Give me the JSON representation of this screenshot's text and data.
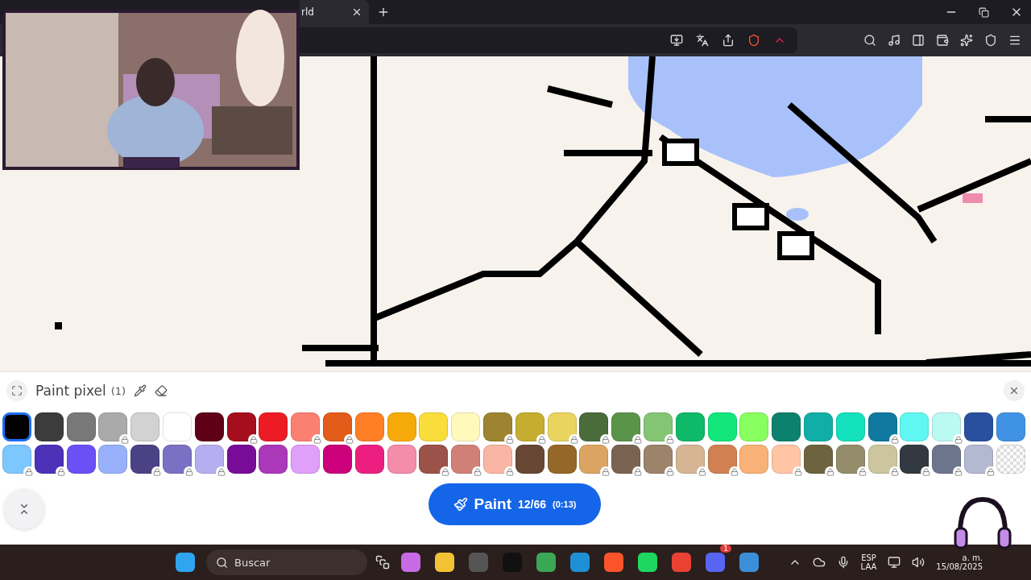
{
  "browser": {
    "tab": {
      "title": "rld"
    }
  },
  "panel": {
    "title": "Paint pixel",
    "count": "(1)",
    "palette": [
      {
        "kind": "color",
        "color": "#000000",
        "locked": false,
        "selected": true
      },
      {
        "kind": "color",
        "color": "#3c3c3c",
        "locked": false,
        "selected": false
      },
      {
        "kind": "color",
        "color": "#787878",
        "locked": false,
        "selected": false
      },
      {
        "kind": "color",
        "color": "#aaaaaa",
        "locked": true,
        "selected": false
      },
      {
        "kind": "color",
        "color": "#d2d2d2",
        "locked": false,
        "selected": false
      },
      {
        "kind": "color",
        "color": "#ffffff",
        "locked": false,
        "selected": false
      },
      {
        "kind": "color",
        "color": "#600018",
        "locked": false,
        "selected": false
      },
      {
        "kind": "color",
        "color": "#a50e1e",
        "locked": true,
        "selected": false
      },
      {
        "kind": "color",
        "color": "#ed1c24",
        "locked": false,
        "selected": false
      },
      {
        "kind": "color",
        "color": "#fa8072",
        "locked": true,
        "selected": false
      },
      {
        "kind": "color",
        "color": "#e45c1a",
        "locked": true,
        "selected": false
      },
      {
        "kind": "color",
        "color": "#ff7f27",
        "locked": false,
        "selected": false
      },
      {
        "kind": "color",
        "color": "#f6aa09",
        "locked": false,
        "selected": false
      },
      {
        "kind": "color",
        "color": "#f9dd3b",
        "locked": false,
        "selected": false
      },
      {
        "kind": "color",
        "color": "#fffabc",
        "locked": false,
        "selected": false
      },
      {
        "kind": "color",
        "color": "#9c8431",
        "locked": true,
        "selected": false
      },
      {
        "kind": "color",
        "color": "#c5ad31",
        "locked": true,
        "selected": false
      },
      {
        "kind": "color",
        "color": "#e8d45f",
        "locked": true,
        "selected": false
      },
      {
        "kind": "color",
        "color": "#4a6b3a",
        "locked": true,
        "selected": false
      },
      {
        "kind": "color",
        "color": "#5a944a",
        "locked": true,
        "selected": false
      },
      {
        "kind": "color",
        "color": "#84c573",
        "locked": true,
        "selected": false
      },
      {
        "kind": "color",
        "color": "#0eb968",
        "locked": false,
        "selected": false
      },
      {
        "kind": "color",
        "color": "#13e67b",
        "locked": false,
        "selected": false
      },
      {
        "kind": "color",
        "color": "#87ff5e",
        "locked": false,
        "selected": false
      },
      {
        "kind": "color",
        "color": "#0c816e",
        "locked": false,
        "selected": false
      },
      {
        "kind": "color",
        "color": "#10aea6",
        "locked": false,
        "selected": false
      },
      {
        "kind": "color",
        "color": "#13e1be",
        "locked": false,
        "selected": false
      },
      {
        "kind": "color",
        "color": "#0f799f",
        "locked": true,
        "selected": false
      },
      {
        "kind": "color",
        "color": "#60f7f2",
        "locked": false,
        "selected": false
      },
      {
        "kind": "color",
        "color": "#bbfaf2",
        "locked": true,
        "selected": false
      },
      {
        "kind": "color",
        "color": "#28509e",
        "locked": false,
        "selected": false
      },
      {
        "kind": "color",
        "color": "#4093e4",
        "locked": false,
        "selected": false
      },
      {
        "kind": "color",
        "color": "#7dc7ff",
        "locked": true,
        "selected": false
      },
      {
        "kind": "color",
        "color": "#4d31b8",
        "locked": true,
        "selected": false
      },
      {
        "kind": "color",
        "color": "#6b50f6",
        "locked": false,
        "selected": false
      },
      {
        "kind": "color",
        "color": "#99b1fb",
        "locked": false,
        "selected": false
      },
      {
        "kind": "color",
        "color": "#4a4284",
        "locked": true,
        "selected": false
      },
      {
        "kind": "color",
        "color": "#7a71c4",
        "locked": true,
        "selected": false
      },
      {
        "kind": "color",
        "color": "#b5aef1",
        "locked": true,
        "selected": false
      },
      {
        "kind": "color",
        "color": "#780c99",
        "locked": false,
        "selected": false
      },
      {
        "kind": "color",
        "color": "#aa38b9",
        "locked": false,
        "selected": false
      },
      {
        "kind": "color",
        "color": "#e09ff9",
        "locked": false,
        "selected": false
      },
      {
        "kind": "color",
        "color": "#cb007a",
        "locked": false,
        "selected": false
      },
      {
        "kind": "color",
        "color": "#ec1f80",
        "locked": false,
        "selected": false
      },
      {
        "kind": "color",
        "color": "#f38da9",
        "locked": false,
        "selected": false
      },
      {
        "kind": "color",
        "color": "#9b5249",
        "locked": true,
        "selected": false
      },
      {
        "kind": "color",
        "color": "#d18078",
        "locked": true,
        "selected": false
      },
      {
        "kind": "color",
        "color": "#fab6a4",
        "locked": true,
        "selected": false
      },
      {
        "kind": "color",
        "color": "#684634",
        "locked": false,
        "selected": false
      },
      {
        "kind": "color",
        "color": "#95682a",
        "locked": false,
        "selected": false
      },
      {
        "kind": "color",
        "color": "#dba463",
        "locked": true,
        "selected": false
      },
      {
        "kind": "color",
        "color": "#7b6352",
        "locked": true,
        "selected": false
      },
      {
        "kind": "color",
        "color": "#9c846b",
        "locked": true,
        "selected": false
      },
      {
        "kind": "color",
        "color": "#d6b594",
        "locked": true,
        "selected": false
      },
      {
        "kind": "color",
        "color": "#d18051",
        "locked": true,
        "selected": false
      },
      {
        "kind": "color",
        "color": "#f8b277",
        "locked": false,
        "selected": false
      },
      {
        "kind": "color",
        "color": "#ffc5a5",
        "locked": true,
        "selected": false
      },
      {
        "kind": "color",
        "color": "#6d643f",
        "locked": true,
        "selected": false
      },
      {
        "kind": "color",
        "color": "#948c6b",
        "locked": true,
        "selected": false
      },
      {
        "kind": "color",
        "color": "#cdc59e",
        "locked": true,
        "selected": false
      },
      {
        "kind": "color",
        "color": "#333941",
        "locked": true,
        "selected": false
      },
      {
        "kind": "color",
        "color": "#6d758d",
        "locked": true,
        "selected": false
      },
      {
        "kind": "color",
        "color": "#b3b9d1",
        "locked": true,
        "selected": false
      },
      {
        "kind": "transparent",
        "locked": false,
        "selected": false
      }
    ],
    "paint_button": {
      "label": "Paint",
      "charges": "12/66",
      "timer": "(0:13)"
    }
  },
  "taskbar": {
    "search": {
      "placeholder": "Buscar"
    },
    "chat_badge": "1",
    "language": "ESP",
    "layout": "LAA",
    "time": "a. m.",
    "date": "15/08/2025"
  }
}
